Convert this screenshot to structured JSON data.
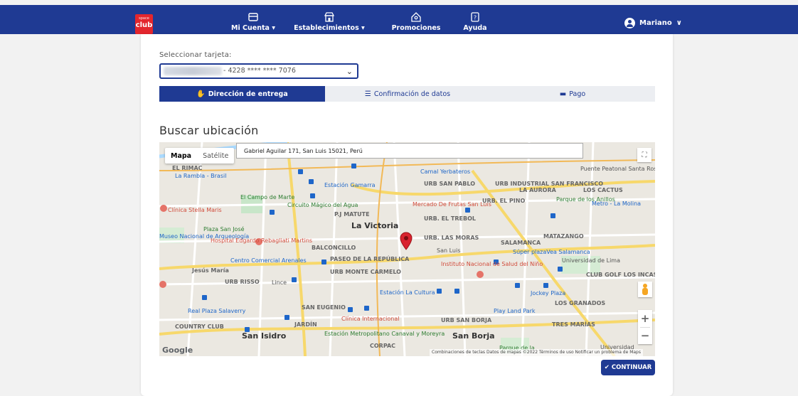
{
  "brand": {
    "logo_small": "space",
    "logo_text": "club"
  },
  "nav": [
    {
      "label": "Mi Cuenta ▾",
      "icon": "card-icon"
    },
    {
      "label": "Establecimientos ▾",
      "icon": "store-icon"
    },
    {
      "label": "Promociones",
      "icon": "tag-icon"
    },
    {
      "label": "Ayuda",
      "icon": "help-icon"
    }
  ],
  "user": {
    "name": "Mariano"
  },
  "card_select": {
    "label": "Seleccionar tarjeta:",
    "value": "- 4228 **** **** 7076"
  },
  "steps": [
    {
      "label": "Dirección de entrega",
      "active": true
    },
    {
      "label": "Confirmación de datos",
      "active": false
    },
    {
      "label": "Pago",
      "active": false
    }
  ],
  "section_title": "Buscar ubicación",
  "map": {
    "type_map": "Mapa",
    "type_satellite": "Satélite",
    "search_value": "Gabriel Aguilar 171, San Luis 15021, Perú",
    "google": "Google",
    "attribution": "Combinaciones de teclas   Datos de mapas ©2022   Términos de uso   Notificar un problema de Maps",
    "labels": [
      "EL RIMAC",
      "La Rambla - Brasil",
      "Estación Gamarra",
      "Camal Yerbateros",
      "URB SAN PABLO",
      "URB INDUSTRIAL SAN FRANCISCO",
      "LA AURORA",
      "LOS CACTUS",
      "Puente Peatonal Santa Rosa - Ate",
      "El Campo de Marte",
      "Circuito Mágico del Agua",
      "Clínica Stella Maris",
      "P.J MATUTE",
      "Mercado De Frutas San Luis",
      "URB. EL PINO",
      "Parque de los Anillos",
      "Metro - La Molina",
      "URB. EL TREBOL",
      "Plaza San José",
      "La Victoria",
      "Museo Nacional de Arqueología",
      "Hospital Edgardo Rebagliati Martins",
      "BALCONCILLO",
      "URB. LAS MORAS",
      "San Luis",
      "SALAMANCA",
      "MATAZANGO",
      "Súper plazaVea Salamanca",
      "Universidad de Lima",
      "Jesús María",
      "Centro Comercial Arenales",
      "PASEO DE LA REPÚBLICA",
      "URB MONTE CARMELO",
      "Instituto Nacional de Salud del Niño",
      "CLUB GOLF LOS INCAS",
      "URB RISSO",
      "Lince",
      "Estación La Cultura",
      "Jockey Plaza",
      "LOS GRANADOS",
      "Real Plaza Salaverry",
      "SAN EUGENIO",
      "Clínica Internacional",
      "URB SAN BORJA",
      "Play Land Park",
      "COUNTRY CLUB",
      "JARDÍN",
      "San Isidro",
      "Estación Metropolitano Canaval y Moreyra",
      "CORPAC",
      "San Borja",
      "Parque de la",
      "TRES MARÍAS",
      "Universidad"
    ]
  },
  "continue_button": "CONTINUAR",
  "colors": {
    "primary": "#1f3a93",
    "brand_red": "#e3262d",
    "pin": "#d9232e"
  }
}
